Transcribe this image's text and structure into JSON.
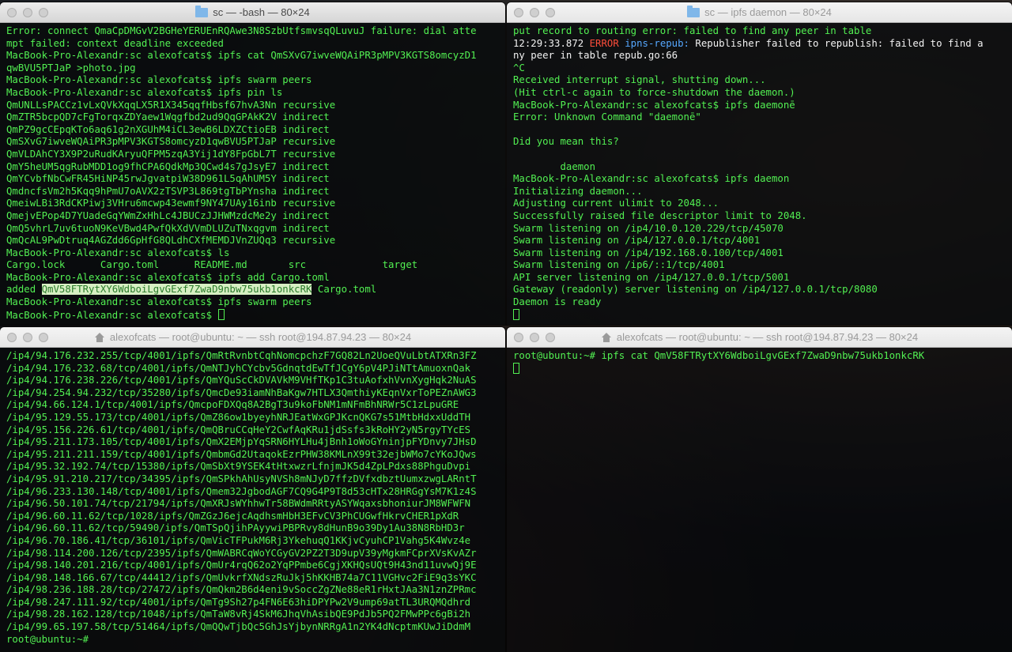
{
  "windows": {
    "tl": {
      "title": "sc — -bash — 80×24",
      "lines": [
        "Error: connect QmaCpDMGvV2BGHeYERUEnRQAwe3N8SzbUtfsmvsqQLuvuJ failure: dial atte",
        "mpt failed: context deadline exceeded",
        "MacBook-Pro-Alexandr:sc alexofcats$ ipfs cat QmSXvG7iwveWQAiPR3pMPV3KGTS8omcyzD1",
        "qwBVU5PTJaP >photo.jpg",
        "MacBook-Pro-Alexandr:sc alexofcats$ ipfs swarm peers",
        "MacBook-Pro-Alexandr:sc alexofcats$ ipfs pin ls",
        "QmUNLLsPACCz1vLxQVkXqqLX5R1X345qqfHbsf67hvA3Nn recursive",
        "QmZTR5bcpQD7cFgTorqxZDYaew1Wqgfbd2ud9QqGPAkK2V indirect",
        "QmPZ9gcCEpqKTo6aq61g2nXGUhM4iCL3ewB6LDXZCtioEB indirect",
        "QmSXvG7iwveWQAiPR3pMPV3KGTS8omcyzD1qwBVU5PTJaP recursive",
        "QmVLDAhCY3X9P2uRudKAryuQFPM5zqA3Yij1dY8FpGbL7T recursive",
        "QmY5heUM5qgRubMDD1og9fhCPA6QdkMp3QCwd4s7gJsyE7 indirect",
        "QmYCvbfNbCwFR45HiNP45rwJgvatpiW38D961L5qAhUM5Y indirect",
        "QmdncfsVm2h5Kqq9hPmU7oAVX2zTSVP3L869tgTbPYnsha indirect",
        "QmeiwLBi3RdCKPiwj3VHru6mcwp43ewmf9NY47UAy16inb recursive",
        "QmejvEPop4D7YUadeGqYWmZxHhLc4JBUCzJJHWMzdcMe2y indirect",
        "QmQ5vhrL7uv6tuoN9KeVBwd4PwfQkXdVVmDLUZuTNxqgvm indirect",
        "QmQcAL9PwDtruq4AGZdd6GpHfG8QLdhCXfMEMDJVnZUQq3 recursive",
        "MacBook-Pro-Alexandr:sc alexofcats$ ls",
        "Cargo.lock      Cargo.toml      README.md       src             target",
        "MacBook-Pro-Alexandr:sc alexofcats$ ipfs add Cargo.toml",
        "MacBook-Pro-Alexandr:sc alexofcats$ ipfs swarm peers",
        "MacBook-Pro-Alexandr:sc alexofcats$ "
      ],
      "added_prefix": "added ",
      "added_hash": "QmV58FTRytXY6WdboiLgvGExf7ZwaD9nbw75ukb1onkcRK",
      "added_suffix": " Cargo.toml"
    },
    "tr": {
      "title": "sc — ipfs daemon — 80×24",
      "line0": "put record to routing error: failed to find any peer in table",
      "time": "12:29:33.872 ",
      "error_word": "ERROR",
      "module": " ipns-repub:",
      "error_msg": " Republisher failed to republish: failed to find a",
      "line1b": "ny peer in table ",
      "source": "repub.go:66",
      "lines": [
        "^C",
        "Received interrupt signal, shutting down...",
        "(Hit ctrl-c again to force-shutdown the daemon.)",
        "MacBook-Pro-Alexandr:sc alexofcats$ ipfs daemonē",
        "Error: Unknown Command \"daemonē\"",
        "",
        "Did you mean this?",
        "",
        "        daemon",
        "MacBook-Pro-Alexandr:sc alexofcats$ ipfs daemon",
        "Initializing daemon...",
        "Adjusting current ulimit to 2048...",
        "Successfully raised file descriptor limit to 2048.",
        "Swarm listening on /ip4/10.0.120.229/tcp/45070",
        "Swarm listening on /ip4/127.0.0.1/tcp/4001",
        "Swarm listening on /ip4/192.168.0.100/tcp/4001",
        "Swarm listening on /ip6/::1/tcp/4001",
        "API server listening on /ip4/127.0.0.1/tcp/5001",
        "Gateway (readonly) server listening on /ip4/127.0.0.1/tcp/8080",
        "Daemon is ready"
      ]
    },
    "bl": {
      "title": "alexofcats — root@ubuntu: ~ — ssh root@194.87.94.23 — 80×24",
      "lines": [
        "/ip4/94.176.232.255/tcp/4001/ipfs/QmRtRvnbtCqhNomcpchzF7GQ82Ln2UoeQVuLbtATXRn3FZ",
        "/ip4/94.176.232.68/tcp/4001/ipfs/QmNTJyhCYcbv5GdnqtdEwTfJCgY6pV4PJiNTtAmuoxnQak",
        "/ip4/94.176.238.226/tcp/4001/ipfs/QmYQuScCkDVAVkM9VHfTKp1C3tuAofxhVvnXygHqk2NuAS",
        "/ip4/94.254.94.232/tcp/35280/ipfs/QmcDe93iamNhBaKgw7HTLX3QmthiyKEqnVxrToPEZnAWG3",
        "/ip4/94.66.124.1/tcp/4001/ipfs/QmcpoFDXQq8A2BgT3u9koFbNM1mNFmBhNRWr5C1zLpuGRE",
        "/ip4/95.129.55.173/tcp/4001/ipfs/QmZ86ow1byeyhNRJEatWxGPJKcnQKG7s51MtbHdxxUddTH",
        "/ip4/95.156.226.61/tcp/4001/ipfs/QmQBruCCqHeY2CwfAqKRu1jdSsfs3kRoHY2yN5rgyTYcES",
        "/ip4/95.211.173.105/tcp/4001/ipfs/QmX2EMjpYqSRN6HYLHu4jBnh1oWoGYninjpFYDnvy7JHsD",
        "/ip4/95.211.211.159/tcp/4001/ipfs/QmbmGd2UtaqokEzrPHW38KMLnX99t32ejbWMo7cYKoJQws",
        "/ip4/95.32.192.74/tcp/15380/ipfs/QmSbXt9YSEK4tHtxwzrLfnjmJK5d4ZpLPdxs88PhguDvpi",
        "/ip4/95.91.210.217/tcp/34395/ipfs/QmSPkhAhUsyNVSh8mNJyD7ffzDVfxdbztUumxzwgLARntT",
        "/ip4/96.233.130.148/tcp/4001/ipfs/Qmem32JgbodAGF7CQ9G4P9T8d53cHTx28HRGgYsM7K1z4S",
        "/ip4/96.50.101.74/tcp/21794/ipfs/QmXRJsWYhhwTr58BWdmRRtyASYWqaxsbhoniurJM8WFWFN",
        "/ip4/96.60.11.62/tcp/1028/ipfs/QmZGzJ6ejcAqdhsmHbH3EFvCV3PhCUGwfHkrvCHER1pXdR",
        "/ip4/96.60.11.62/tcp/59490/ipfs/QmTSpQjihPAyywiPBPRvy8dHunB9o39Dy1Au38N8RbHD3r",
        "/ip4/96.70.186.41/tcp/36101/ipfs/QmVicTFPukM6Rj3YkehuqQ1KKjvCyuhCP1Vahg5K4Wvz4e",
        "/ip4/98.114.200.126/tcp/2395/ipfs/QmWABRCqWoYCGyGV2PZ2T3D9upV39yMgkmFCprXVsKvAZr",
        "/ip4/98.140.201.216/tcp/4001/ipfs/QmUr4rqQ62o2YqPPmbe6CgjXKHQsUQt9H43nd11uvwQj9E",
        "/ip4/98.148.166.67/tcp/44412/ipfs/QmUvkrfXNdszRuJkj5hKKHB74a7C11VGHvc2FiE9q3sYKC",
        "/ip4/98.236.188.28/tcp/27472/ipfs/QmQkm2B6d4eni9vSoccZgZNe88eR1rHxtJAa3N1znZPRmc",
        "/ip4/98.247.111.92/tcp/4001/ipfs/QmTg9Sh27p4FN6E63hiDPYPw2V9ump69atTL3URQMQdhrd",
        "/ip4/98.28.162.128/tcp/1048/ipfs/QmTaW8vRj4SkM6JhqVhAsibQE9PdJb5PQ2FMwPPc6gBi2h",
        "/ip4/99.65.197.58/tcp/51464/ipfs/QmQQwTjbQc5GhJsYjbynNRRgA1n2YK4dNcptmKUwJiDdmM",
        "root@ubuntu:~# "
      ]
    },
    "br": {
      "title": "alexofcats — root@ubuntu: ~ — ssh root@194.87.94.23 — 80×24",
      "command": "root@ubuntu:~# ipfs cat QmV58FTRytXY6WdboiLgvGExf7ZwaD9nbw75ukb1onkcRK"
    }
  },
  "colors": {
    "terminal_text": "#52f052",
    "error": "#ff4d3a",
    "module": "#56a8ff"
  },
  "icons": {
    "folder": "folder-icon",
    "home": "home-icon"
  }
}
